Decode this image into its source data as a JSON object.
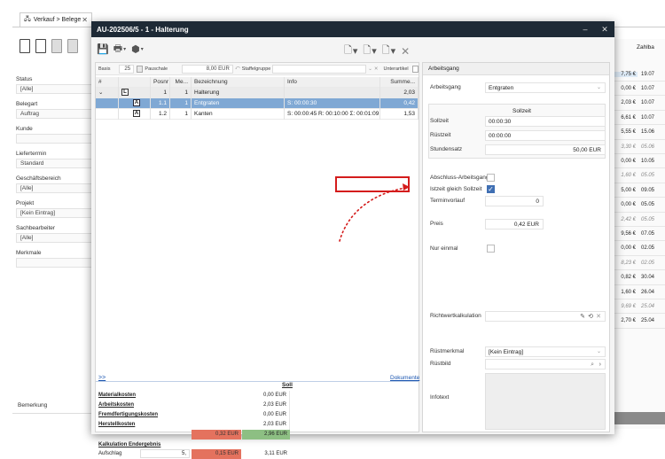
{
  "background": {
    "tab_label": "Verkauf > Belege",
    "filters": [
      {
        "label": "Status",
        "value": "[Alle]"
      },
      {
        "label": "Belegart",
        "value": "Auftrag"
      },
      {
        "label": "Kunde",
        "value": ""
      },
      {
        "label": "Liefertermin",
        "value": "Standard"
      },
      {
        "label": "Geschäftsbereich",
        "value": "[Alle]"
      },
      {
        "label": "Projekt",
        "value": "[Kein Eintrag]"
      },
      {
        "label": "Sachbearbeiter",
        "value": "[Alle]"
      },
      {
        "label": "Merkmale",
        "value": ""
      }
    ],
    "bemerkung_label": "Bemerkung",
    "right_column_header": "Zahlba",
    "right_rows": [
      {
        "v1": "7,75 €",
        "v2": "19.07",
        "style": "hl"
      },
      {
        "v1": "0,00 €",
        "v2": "10.07",
        "style": ""
      },
      {
        "v1": "2,03 €",
        "v2": "10.07",
        "style": ""
      },
      {
        "v1": "6,61 €",
        "v2": "10.07",
        "style": ""
      },
      {
        "v1": "5,55 €",
        "v2": "15.06",
        "style": ""
      },
      {
        "v1": "3,30 €",
        "v2": "05.06",
        "style": "italic"
      },
      {
        "v1": "0,00 €",
        "v2": "10.05",
        "style": ""
      },
      {
        "v1": "1,60 €",
        "v2": "05.05",
        "style": "italic"
      },
      {
        "v1": "5,00 €",
        "v2": "09.05",
        "style": ""
      },
      {
        "v1": "0,00 €",
        "v2": "05.05",
        "style": ""
      },
      {
        "v1": "2,42 €",
        "v2": "05.05",
        "style": "italic"
      },
      {
        "v1": "9,56 €",
        "v2": "07.05",
        "style": ""
      },
      {
        "v1": "0,00 €",
        "v2": "02.05",
        "style": ""
      },
      {
        "v1": "8,23 €",
        "v2": "02.05",
        "style": "italic"
      },
      {
        "v1": "0,82 €",
        "v2": "30.04",
        "style": ""
      },
      {
        "v1": "1,60 €",
        "v2": "26.04",
        "style": ""
      },
      {
        "v1": "9,69 €",
        "v2": "25.04",
        "style": "italic"
      },
      {
        "v1": "2,70 €",
        "v2": "25.04",
        "style": ""
      }
    ]
  },
  "dialog": {
    "title": "AU-202506/5 - 1 - Halterung",
    "minimize": "–",
    "close": "✕",
    "basis_row": {
      "basis_label": "Basis",
      "basis_value": "25",
      "pauschale_label": "Pauschale",
      "pauschale_value": "8,00 EUR",
      "staffel_label": "Staffelgruppe",
      "staffel_value": "",
      "unterartikel_label": "Unterartikel"
    },
    "grid": {
      "headers": [
        "#",
        "",
        "Posnr",
        "Me...",
        "Bezeichnung",
        "Info",
        "Summe..."
      ],
      "rows": [
        {
          "type": "grp",
          "posnr": "1",
          "menge": "1",
          "bezeichnung": "Halterung",
          "info": "",
          "summe": "2,03"
        },
        {
          "type": "sel",
          "posnr": "1.1",
          "menge": "1",
          "bezeichnung": "Entgraten",
          "info": "S: 00:00:30",
          "summe": "0,42"
        },
        {
          "type": "row",
          "posnr": "1.2",
          "menge": "1",
          "bezeichnung": "Kanten",
          "info": "S: 00:00:45 R: 00:10:00 Σ: 00:01:09",
          "summe": "1,53"
        }
      ]
    },
    "expand_link": ">>",
    "documents_link": "Dokumente",
    "soll_header": "Soll",
    "costs": [
      {
        "label": "Materialkosten",
        "value": "0,00 EUR"
      },
      {
        "label": "Arbeitskosten",
        "value": "2,03 EUR"
      },
      {
        "label": "Fremdfertigungskosten",
        "value": "0,00 EUR"
      },
      {
        "label": "Herstellkosten",
        "value": "2,03 EUR"
      }
    ],
    "calc_row": {
      "red_value": "0,32 EUR",
      "green_value": "2,96 EUR"
    },
    "endergebnis_label": "Kalkulation Endergebnis",
    "aufschlag": {
      "label": "Aufschlag",
      "value": "5,",
      "red_value": "0,15 EUR",
      "result": "3,11 EUR"
    },
    "right_panel": {
      "header": "Arbeitsgang",
      "arbeitsgang_label": "Arbeitsgang",
      "arbeitsgang_value": "Entgraten",
      "sollzeit_header": "Sollzeit",
      "sollzeit_label": "Sollzeit",
      "sollzeit_value": "00:00:30",
      "ruestzeit_label": "Rüstzeit",
      "ruestzeit_value": "00:00:00",
      "stundensatz_label": "Stundensatz",
      "stundensatz_value": "50,00 EUR",
      "abschluss_label": "Abschluss-Arbeitsgang",
      "istzeit_label": "Istzeit gleich Sollzeit",
      "termin_label": "Terminvorlauf",
      "termin_value": "0",
      "preis_label": "Preis",
      "preis_value": "0,42 EUR",
      "nur_einmal_label": "Nur einmal",
      "richtwert_label": "Richtwertkalkulation",
      "ruestmerkmal_label": "Rüstmerkmal",
      "ruestmerkmal_value": "[Kein Eintrag]",
      "ruestbild_label": "Rüstbild",
      "infotext_label": "Infotext"
    }
  },
  "colors": {
    "titlebar": "#1e2a36",
    "selection": "#7fa8d4",
    "highlight_box": "#d41c1c",
    "red_cell": "#e4725e",
    "green_cell": "#8dbf83",
    "checkbox_checked": "#3f6fb3"
  }
}
